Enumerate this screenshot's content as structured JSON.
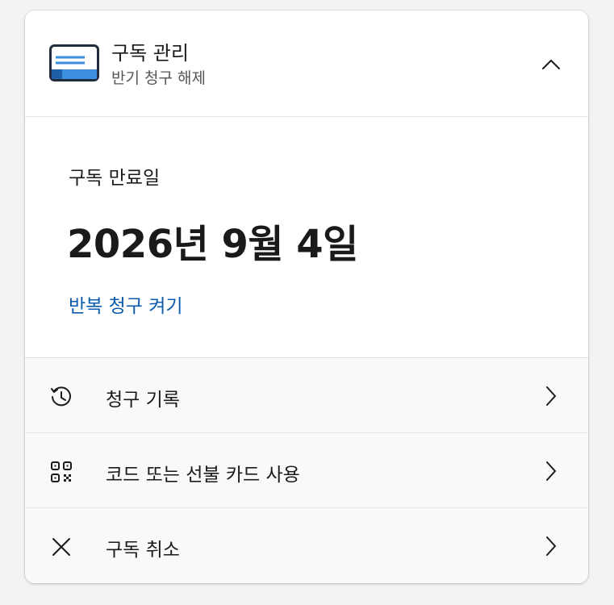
{
  "header": {
    "title": "구독 관리",
    "subtitle": "반기 청구 해제",
    "app_icon": "subscription-card-icon",
    "collapse_icon": "chevron-up-icon"
  },
  "expiry": {
    "label": "구독 만료일",
    "date": "2026년 9월 4일",
    "link": "반복 청구 켜기"
  },
  "options": [
    {
      "label": "청구 기록",
      "icon": "history-icon",
      "chevron": "chevron-right-icon"
    },
    {
      "label": "코드 또는 선불 카드 사용",
      "icon": "qr-code-icon",
      "chevron": "chevron-right-icon"
    },
    {
      "label": "구독 취소",
      "icon": "close-icon",
      "chevron": "chevron-right-icon"
    }
  ],
  "colors": {
    "link": "#0b5cad",
    "icon_blue": "#3b8fde",
    "icon_dark": "#1f2d3d"
  }
}
